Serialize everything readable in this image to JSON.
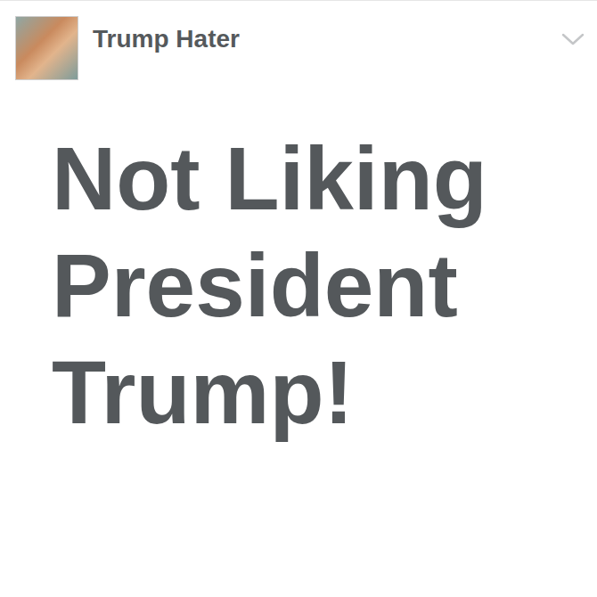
{
  "post": {
    "author": "Trump Hater",
    "text": "Not Liking President Trump!"
  }
}
